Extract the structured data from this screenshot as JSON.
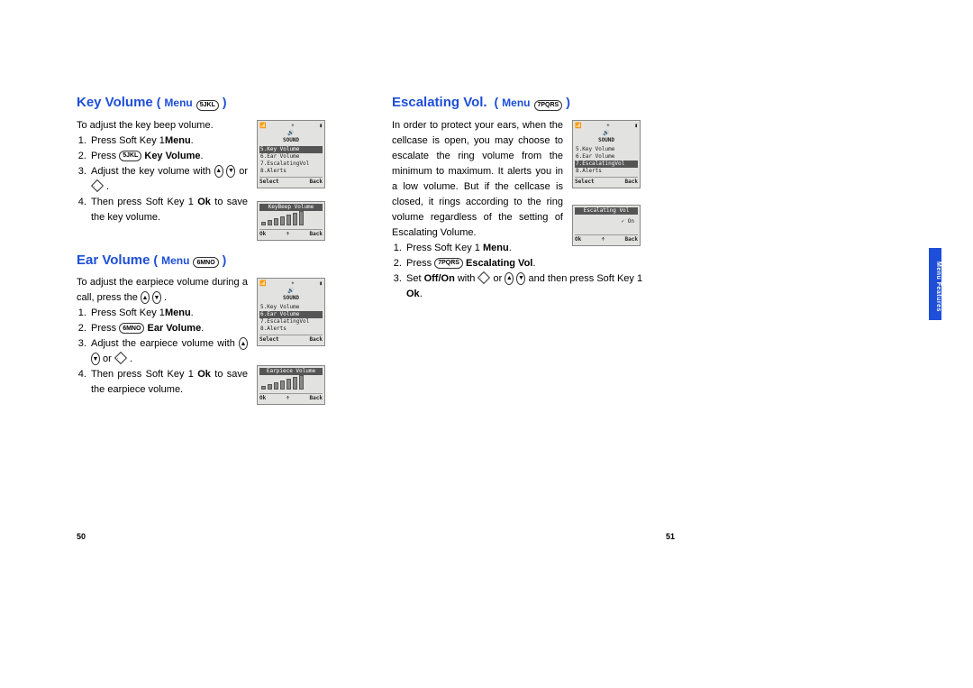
{
  "left": {
    "section1": {
      "title": "Key Volume",
      "menu_word": "Menu",
      "menu_key": "5JKL",
      "intro": "To adjust the key beep volume.",
      "step1_a": "Press  Soft Key 1",
      "step1_b": "Menu",
      "step1_c": ".",
      "step2_a": "Press ",
      "step2_key": "5JKL",
      "step2_b": "Key Volume",
      "step2_c": ".",
      "step3_a": "Adjust the key volume with ",
      "step3_b": " or ",
      "step3_c": " .",
      "step4_a": "Then press Soft Key 1 ",
      "step4_b": "Ok",
      "step4_c": " to save the key volume.",
      "shot1": {
        "title": "SOUND",
        "rows": [
          "5.Key Volume",
          "6.Ear Volume",
          "7.EscalatingVol",
          "8.Alerts"
        ],
        "hl": 0,
        "foot_l": "Select",
        "foot_r": "Back"
      },
      "shot2": {
        "title": "KeyBeep Volume",
        "foot_l": "Ok",
        "foot_m": "÷",
        "foot_r": "Back"
      }
    },
    "section2": {
      "title": "Ear Volume",
      "menu_word": "Menu",
      "menu_key": "6MNO",
      "intro_a": "To adjust the earpiece volume during a call, press the ",
      "intro_b": " .",
      "step1_a": "Press  Soft Key 1",
      "step1_b": "Menu",
      "step1_c": ".",
      "step2_a": "Press ",
      "step2_key": "6MNO",
      "step2_b": "Ear Volume",
      "step2_c": ".",
      "step3_a": "Adjust the earpiece volume with ",
      "step3_b": " or ",
      "step3_c": " .",
      "step4_a": "Then press Soft Key 1 ",
      "step4_b": "Ok",
      "step4_c": " to save the earpiece volume.",
      "shot1": {
        "title": "SOUND",
        "rows": [
          "5.Key Volume",
          "6.Ear Volume",
          "7.EscalatingVol",
          "8.Alerts"
        ],
        "hl": 1,
        "foot_l": "Select",
        "foot_r": "Back"
      },
      "shot2": {
        "title": "Earpiece Volume",
        "foot_l": "Ok",
        "foot_m": "÷",
        "foot_r": "Back"
      }
    },
    "page_num": "50"
  },
  "right": {
    "section1": {
      "title": "Escalating Vol.",
      "menu_word": "Menu",
      "menu_key": "7PQRS",
      "intro": "In order to protect your ears, when the cellcase is open, you may choose to escalate the ring volume from the minimum to maximum. It alerts you in a low volume. But if the cellcase is closed, it rings according to the ring volume regardless of the setting of Escalating Volume.",
      "step1_a": "Press Soft Key 1 ",
      "step1_b": "Menu",
      "step1_c": ".",
      "step2_a": "Press ",
      "step2_key": "7PQRS",
      "step2_b": "Escalating Vol",
      "step2_c": ".",
      "step3_a": "Set ",
      "step3_b": "Off/On",
      "step3_c": " with ",
      "step3_d": " or ",
      "step3_e": " and then press Soft Key 1 ",
      "step3_f": "Ok",
      "step3_g": ".",
      "shot1": {
        "title": "SOUND",
        "rows": [
          "5.Key Volume",
          "6.Ear Volume",
          "7.EscalatingVol",
          "8.Alerts"
        ],
        "hl": 2,
        "foot_l": "Select",
        "foot_r": "Back"
      },
      "shot2": {
        "title": "Escalating Vol",
        "row": "✓ On",
        "foot_l": "Ok",
        "foot_m": "÷",
        "foot_r": "Back"
      }
    },
    "page_num": "51",
    "tab": "Menu Features"
  }
}
